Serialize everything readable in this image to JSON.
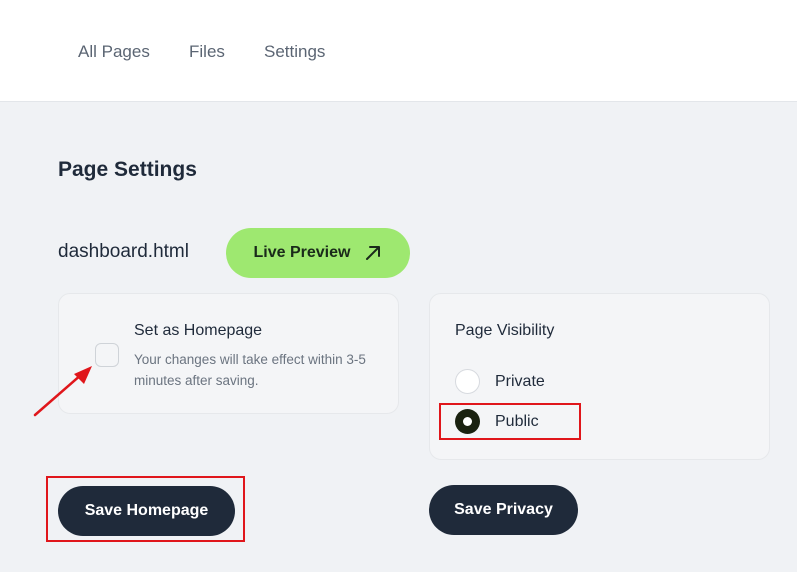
{
  "nav": {
    "all_pages": "All Pages",
    "files": "Files",
    "settings": "Settings"
  },
  "page_title": "Page Settings",
  "file": {
    "name": "dashboard.html",
    "live_preview_label": "Live Preview",
    "live_preview_icon": "arrow-up-right-icon"
  },
  "homepage_card": {
    "title": "Set as Homepage",
    "description": "Your changes will take effect within 3-5 minutes after saving.",
    "checked": false
  },
  "visibility_card": {
    "title": "Page Visibility",
    "options": [
      {
        "label": "Private",
        "selected": false
      },
      {
        "label": "Public",
        "selected": true
      }
    ]
  },
  "buttons": {
    "save_homepage": "Save Homepage",
    "save_privacy": "Save Privacy"
  },
  "colors": {
    "accent_green": "#9ee870",
    "dark_button": "#1f2a3a",
    "annotation_red": "#e0161b"
  }
}
